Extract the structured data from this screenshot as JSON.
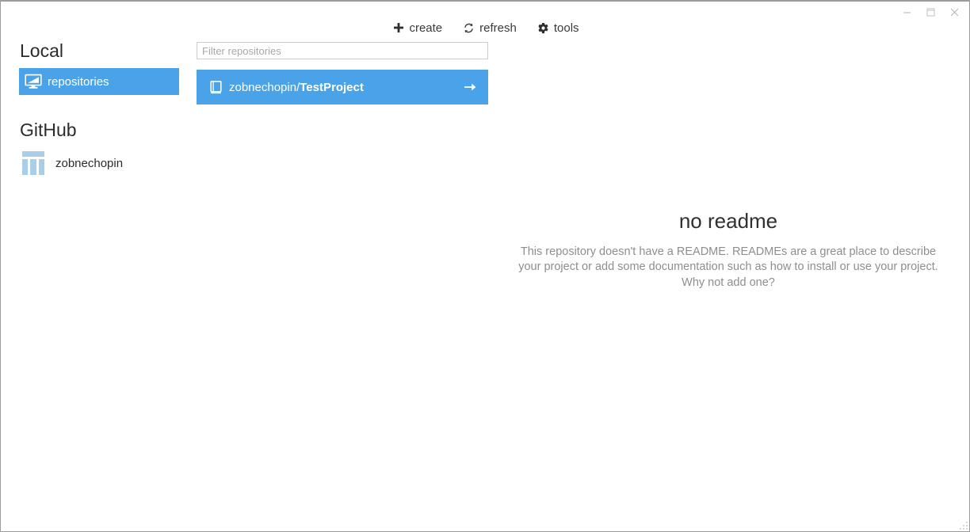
{
  "window": {
    "title": "",
    "controls": [
      {
        "name": "minimize",
        "glyph": "minimize-icon",
        "tooltip": "Minimize"
      },
      {
        "name": "maximize",
        "glyph": "maximize-icon",
        "tooltip": "Maximize"
      },
      {
        "name": "close",
        "glyph": "close-icon",
        "tooltip": "Close"
      }
    ]
  },
  "toolbar": {
    "create_label": "create",
    "create_icon": "plus-icon",
    "refresh_label": "refresh",
    "refresh_icon": "refresh-icon",
    "tools_label": "tools",
    "tools_icon": "gear-icon"
  },
  "sidebar": {
    "local_heading": "Local",
    "local_items": [
      {
        "label": "repositories",
        "icon": "monitor-icon",
        "selected": true
      }
    ],
    "github_heading": "GitHub",
    "accounts": [
      {
        "label": "zobnechopin",
        "icon": "avatar-identicon"
      }
    ]
  },
  "repositories": {
    "filter_placeholder": "Filter repositories",
    "filter_value": "",
    "items": [
      {
        "owner": "zobnechopin/",
        "project": "TestProject",
        "icon": "book-icon",
        "arrow_icon": "arrow-right-icon",
        "selected": true
      }
    ]
  },
  "readme": {
    "title": "no readme",
    "body": "This repository doesn't have a README. READMEs are a great place to describe your project or add some documentation such as how to install or use your project. Why not add one?"
  },
  "colors": {
    "accent_blue": "#4aa3e8",
    "text_dark": "#2c2c2c",
    "text_muted": "#8e8e8e",
    "border_gray": "#cccccc",
    "avatar_blue": "#a9cfe8"
  }
}
